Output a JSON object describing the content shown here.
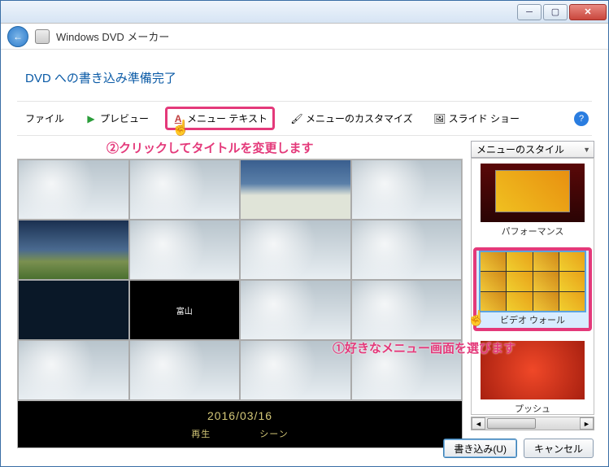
{
  "app_title": "Windows DVD メーカー",
  "heading": "DVD への書き込み準備完了",
  "toolbar": {
    "file": "ファイル",
    "preview": "プレビュー",
    "menu_text": "メニュー テキスト",
    "customize": "メニューのカスタマイズ",
    "slideshow": "スライド ショー"
  },
  "dropdown_label": "メニューのスタイル",
  "preview": {
    "cell_title": "富山",
    "date": "2016/03/16",
    "play": "再生",
    "scene": "シーン"
  },
  "styles": {
    "performance": "パフォーマンス",
    "video_wall": "ビデオ ウォール",
    "push": "プッシュ"
  },
  "buttons": {
    "burn": "書き込み(U)",
    "cancel": "キャンセル"
  },
  "annotations": {
    "a1": "①好きなメニュー画面を選びます",
    "a2": "②クリックしてタイトルを変更します"
  },
  "cursor_glyph": "☝"
}
